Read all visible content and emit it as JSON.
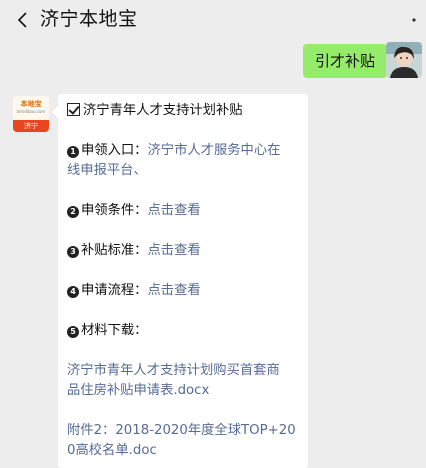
{
  "header": {
    "title": "济宁本地宝",
    "back_icon": "chevron-left-icon",
    "more_icon": "more-dots-icon"
  },
  "outgoing": {
    "text": "引才补贴"
  },
  "bot": {
    "avatar_top": "本地宝",
    "avatar_sub": "bendibao.com",
    "avatar_bottom": "济宁"
  },
  "message": {
    "title": "济宁青年人才支持计划补贴",
    "item1_num": "1",
    "item1_label": "申领入口：",
    "item1_link_a": "济宁市人才服务中心在",
    "item1_link_b": "线申报平台",
    "item1_suffix": "、",
    "item2_num": "2",
    "item2_label": "申领条件：",
    "item2_link": "点击查看",
    "item3_num": "3",
    "item3_label": "补贴标准：",
    "item3_link": "点击查看",
    "item4_num": "4",
    "item4_label": "申请流程：",
    "item4_link": "点击查看",
    "item5_num": "5",
    "item5_label": "材料下载：",
    "file1_a": "济宁市青年人才支持计划购买首套商",
    "file1_b": "品住房补贴申请表.docx",
    "file2_a": "附件2：2018-2020年度全球TOP+20",
    "file2_b": "0高校名单.doc"
  },
  "colors": {
    "background": "#ededed",
    "outgoing_bubble": "#95ec69",
    "incoming_bubble": "#ffffff",
    "link": "#576b95",
    "brand": "#e8471e"
  }
}
